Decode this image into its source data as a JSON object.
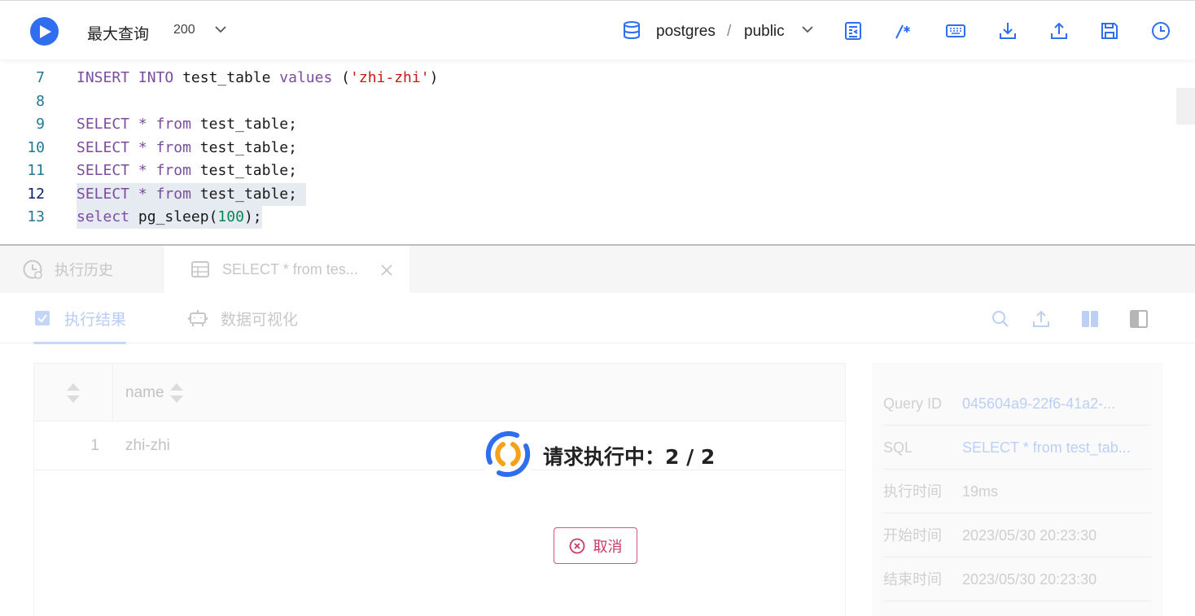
{
  "toolbar": {
    "max_query_label": "最大查询",
    "max_query_value": "200",
    "database": "postgres",
    "separator": "/",
    "schema": "public",
    "accent_color": "#2f6fef",
    "icons": [
      "run-icon",
      "chevron-down-icon",
      "database-icon",
      "format-icon",
      "comment-icon",
      "keyboard-icon",
      "download-icon",
      "upload-icon",
      "save-icon",
      "history-clock-icon"
    ]
  },
  "editor": {
    "lines": [
      {
        "num": "7",
        "code": "INSERT INTO test_table values ('zhi-zhi')"
      },
      {
        "num": "8",
        "code": ""
      },
      {
        "num": "9",
        "code": "SELECT * from test_table;"
      },
      {
        "num": "10",
        "code": "SELECT * from test_table;"
      },
      {
        "num": "11",
        "code": "SELECT * from test_table;"
      },
      {
        "num": "12",
        "code": "SELECT * from test_table;"
      },
      {
        "num": "13",
        "code": "select pg_sleep(100);"
      }
    ],
    "tokens": {
      "insert": "INSERT",
      "into": "INTO",
      "table": "test_table",
      "values": "values",
      "str": "'zhi-zhi'",
      "select": "SELECT",
      "star": "*",
      "from": "from",
      "table_semi": "test_table;",
      "select_lower": "select",
      "fn": "pg_sleep",
      "num": "100",
      "close": ");"
    }
  },
  "tabs": {
    "history": "执行历史",
    "result": "SELECT * from tes..."
  },
  "subtabs": {
    "result": "执行结果",
    "visualize": "数据可视化"
  },
  "grid": {
    "columns": [
      "name"
    ],
    "rows": [
      {
        "idx": "1",
        "name": "zhi-zhi"
      }
    ]
  },
  "info": [
    {
      "key": "Query ID",
      "value": "045604a9-22f6-41a2-..."
    },
    {
      "key": "SQL",
      "value": "SELECT * from test_tab..."
    },
    {
      "key": "执行时间",
      "value": "19ms"
    },
    {
      "key": "开始时间",
      "value": "2023/05/30 20:23:30"
    },
    {
      "key": "结束时间",
      "value": "2023/05/30 20:23:30"
    }
  ],
  "loading": {
    "text": "请求执行中：2 / 2",
    "cancel_label": "取消"
  }
}
